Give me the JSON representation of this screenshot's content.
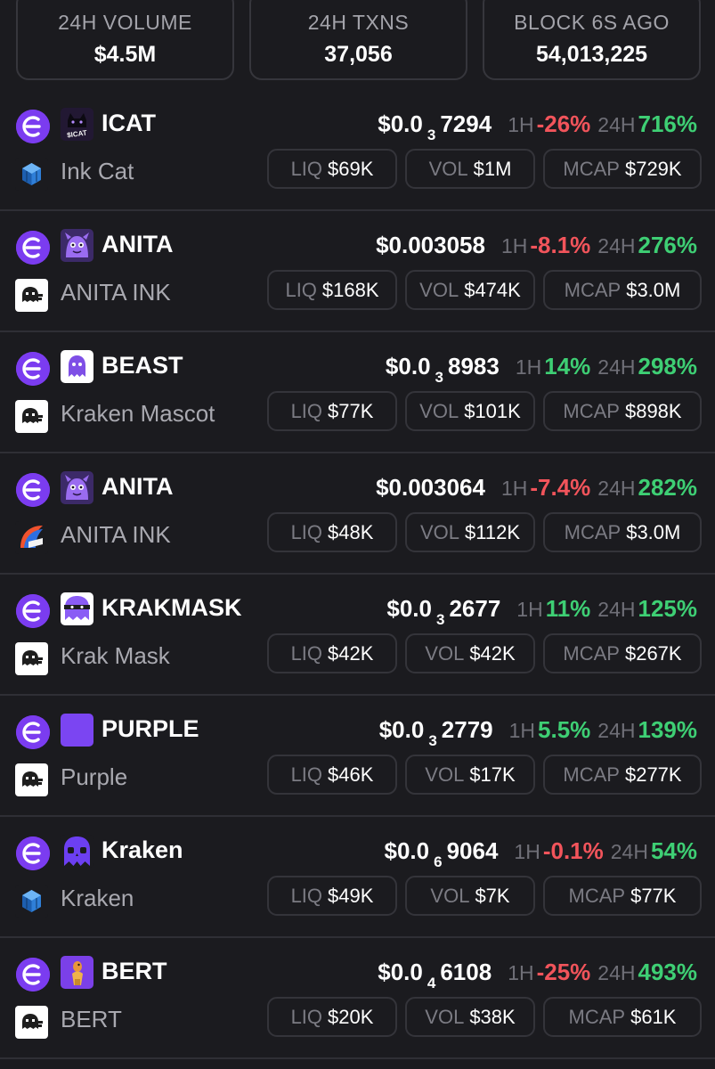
{
  "stats": [
    {
      "label": "24H VOLUME",
      "value": "$4.5M"
    },
    {
      "label": "24H TXNS",
      "value": "37,056"
    },
    {
      "label": "BLOCK 6S AGO",
      "value": "54,013,225"
    }
  ],
  "labels": {
    "one_hour": "1H",
    "twenty_four_hour": "24H",
    "liq": "LIQ",
    "vol": "VOL",
    "mcap": "MCAP"
  },
  "colors": {
    "positive": "#3ecf74",
    "negative": "#f2545b",
    "chain_purple": "#7b3cf0"
  },
  "tokens": [
    {
      "symbol": "ICAT",
      "name": "Ink Cat",
      "avatar_icon": "icat-logo-icon",
      "avatar_text": "$ICAT",
      "dex_icon": "cube-dex-icon",
      "price_prefix": "$0.0",
      "price_zeros": "3",
      "price_digits": "7294",
      "change_1h": "-26%",
      "change_1h_dir": "down",
      "change_24h": "716%",
      "change_24h_dir": "up",
      "liq": "$69K",
      "vol": "$1M",
      "mcap": "$729K"
    },
    {
      "symbol": "ANITA",
      "name": "ANITA INK",
      "avatar_icon": "purple-monster-icon",
      "dex_icon": "kraken-dex-icon",
      "price_prefix": "$0.003058",
      "price_zeros": "",
      "price_digits": "",
      "change_1h": "-8.1%",
      "change_1h_dir": "down",
      "change_24h": "276%",
      "change_24h_dir": "up",
      "liq": "$168K",
      "vol": "$474K",
      "mcap": "$3.0M"
    },
    {
      "symbol": "BEAST",
      "name": "Kraken Mascot",
      "avatar_icon": "purple-ghost-icon",
      "dex_icon": "kraken-dex-icon",
      "price_prefix": "$0.0",
      "price_zeros": "3",
      "price_digits": "8983",
      "change_1h": "14%",
      "change_1h_dir": "up",
      "change_24h": "298%",
      "change_24h_dir": "up",
      "liq": "$77K",
      "vol": "$101K",
      "mcap": "$898K"
    },
    {
      "symbol": "ANITA",
      "name": "ANITA INK",
      "avatar_icon": "purple-monster-icon",
      "dex_icon": "arc-dex-icon",
      "price_prefix": "$0.003064",
      "price_zeros": "",
      "price_digits": "",
      "change_1h": "-7.4%",
      "change_1h_dir": "down",
      "change_24h": "282%",
      "change_24h_dir": "up",
      "liq": "$48K",
      "vol": "$112K",
      "mcap": "$3.0M"
    },
    {
      "symbol": "KRAKMASK",
      "name": "Krak Mask",
      "avatar_icon": "kraken-mask-icon",
      "dex_icon": "kraken-dex-icon",
      "price_prefix": "$0.0",
      "price_zeros": "3",
      "price_digits": "2677",
      "change_1h": "11%",
      "change_1h_dir": "up",
      "change_24h": "125%",
      "change_24h_dir": "up",
      "liq": "$42K",
      "vol": "$42K",
      "mcap": "$267K"
    },
    {
      "symbol": "PURPLE",
      "name": "Purple",
      "avatar_icon": "purple-square-icon",
      "dex_icon": "kraken-dex-icon",
      "price_prefix": "$0.0",
      "price_zeros": "3",
      "price_digits": "2779",
      "change_1h": "5.5%",
      "change_1h_dir": "up",
      "change_24h": "139%",
      "change_24h_dir": "up",
      "liq": "$46K",
      "vol": "$17K",
      "mcap": "$277K"
    },
    {
      "symbol": "Kraken",
      "name": "Kraken",
      "avatar_icon": "kraken-skull-icon",
      "dex_icon": "cube-dex-icon",
      "price_prefix": "$0.0",
      "price_zeros": "6",
      "price_digits": "9064",
      "change_1h": "-0.1%",
      "change_1h_dir": "down",
      "change_24h": "54%",
      "change_24h_dir": "up",
      "liq": "$49K",
      "vol": "$7K",
      "mcap": "$77K"
    },
    {
      "symbol": "BERT",
      "name": "BERT",
      "avatar_icon": "bert-figure-icon",
      "dex_icon": "kraken-dex-icon",
      "price_prefix": "$0.0",
      "price_zeros": "4",
      "price_digits": "6108",
      "change_1h": "-25%",
      "change_1h_dir": "down",
      "change_24h": "493%",
      "change_24h_dir": "up",
      "liq": "$20K",
      "vol": "$38K",
      "mcap": "$61K"
    }
  ]
}
